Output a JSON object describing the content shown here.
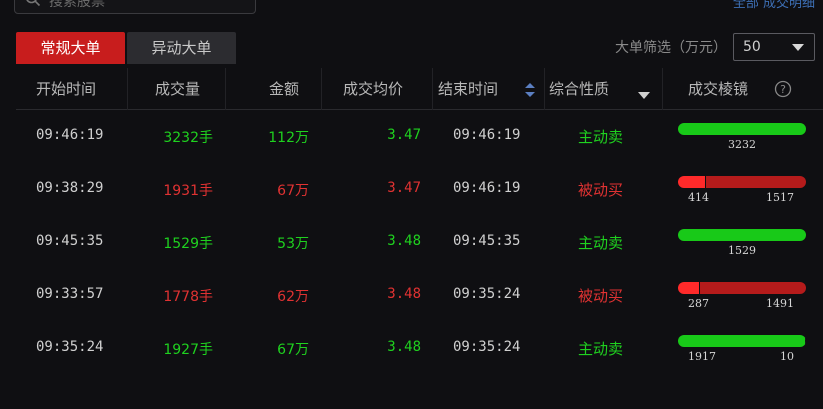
{
  "top": {
    "search_placeholder": "搜索股票",
    "right_link": "全部 成交明细"
  },
  "tabs": [
    {
      "label": "常规大单",
      "active": true
    },
    {
      "label": "异动大单",
      "active": false
    }
  ],
  "filter": {
    "label": "大单筛选（万元）",
    "value": "50"
  },
  "columns": {
    "start": "开始时间",
    "volume": "成交量",
    "amount": "金额",
    "avg": "成交均价",
    "end": "结束时间",
    "nature": "综合性质",
    "prism": "成交棱镜"
  },
  "colors": {
    "buy_active": "#1fd11f",
    "sell_passive": "#e03232",
    "bar_green": "#18c918",
    "bar_red_dark": "#b51b1b",
    "bar_red_light": "#ff2a2a",
    "bar_green_light": "#3fb53f"
  },
  "rows": [
    {
      "start": "09:46:19",
      "volume": "3232手",
      "amount": "112万",
      "avg": "3.47",
      "end": "09:46:19",
      "nature": "主动卖",
      "color": "green",
      "prism": {
        "a": 3232,
        "b": 0,
        "label_a": "3232",
        "label_b": "",
        "kind": "green"
      }
    },
    {
      "start": "09:38:29",
      "volume": "1931手",
      "amount": "67万",
      "avg": "3.47",
      "end": "09:46:19",
      "nature": "被动买",
      "color": "red",
      "prism": {
        "a": 414,
        "b": 1517,
        "label_a": "414",
        "label_b": "1517",
        "kind": "red"
      }
    },
    {
      "start": "09:45:35",
      "volume": "1529手",
      "amount": "53万",
      "avg": "3.48",
      "end": "09:45:35",
      "nature": "主动卖",
      "color": "green",
      "prism": {
        "a": 1529,
        "b": 0,
        "label_a": "1529",
        "label_b": "",
        "kind": "green"
      }
    },
    {
      "start": "09:33:57",
      "volume": "1778手",
      "amount": "62万",
      "avg": "3.48",
      "end": "09:35:24",
      "nature": "被动买",
      "color": "red",
      "prism": {
        "a": 287,
        "b": 1491,
        "label_a": "287",
        "label_b": "1491",
        "kind": "red"
      }
    },
    {
      "start": "09:35:24",
      "volume": "1927手",
      "amount": "67万",
      "avg": "3.48",
      "end": "09:35:24",
      "nature": "主动卖",
      "color": "green",
      "prism": {
        "a": 1917,
        "b": 10,
        "label_a": "1917",
        "label_b": "10",
        "kind": "green"
      }
    }
  ]
}
